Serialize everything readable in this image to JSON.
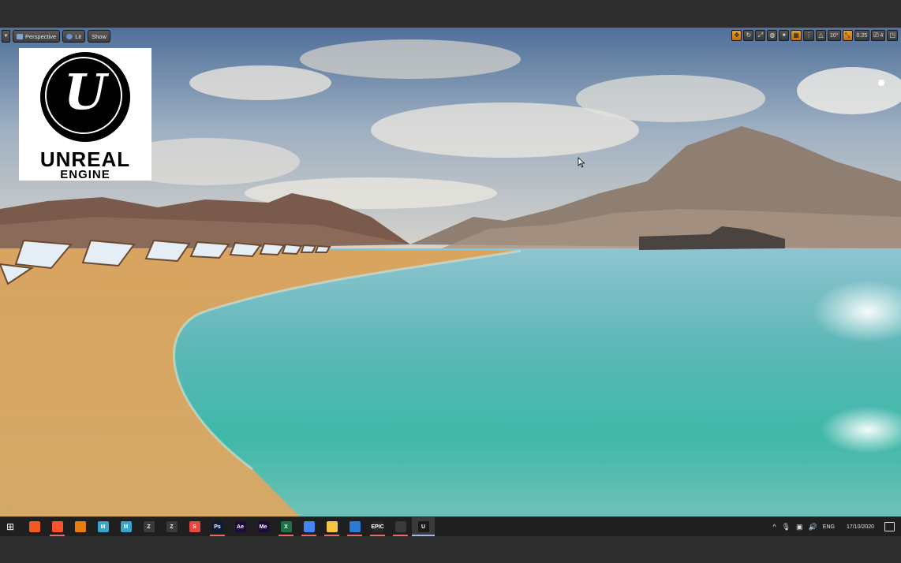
{
  "viewport": {
    "toolbar_left": {
      "perspective_label": "Perspective",
      "lit_label": "Lit",
      "show_label": "Show"
    },
    "toolbar_right": {
      "snap_angle": "10°",
      "camera_speed_value": "0.25",
      "camera_speed": "4"
    },
    "logo": {
      "glyph": "U",
      "line1": "UNREAL",
      "line2": "ENGINE"
    }
  },
  "taskbar": {
    "apps": [
      {
        "name": "origin-icon",
        "label": "",
        "color": "#f05a22",
        "running": false
      },
      {
        "name": "brave-icon",
        "label": "",
        "color": "#fb542b",
        "running": true
      },
      {
        "name": "blender-icon",
        "label": "",
        "color": "#e87d0d",
        "running": false
      },
      {
        "name": "maya-icon",
        "label": "M",
        "color": "#37a5cc",
        "running": false
      },
      {
        "name": "maya-2-icon",
        "label": "M",
        "color": "#37a5cc",
        "running": false
      },
      {
        "name": "zbrush-icon",
        "label": "Z",
        "color": "#3a3a3a",
        "running": false
      },
      {
        "name": "zbrush-2-icon",
        "label": "Z",
        "color": "#3a3a3a",
        "running": false
      },
      {
        "name": "substance-icon",
        "label": "S",
        "color": "#e2483d",
        "running": false
      },
      {
        "name": "photoshop-icon",
        "label": "Ps",
        "color": "#0a1e3a",
        "running": true
      },
      {
        "name": "after-effects-icon",
        "label": "Ae",
        "color": "#1f0a3a",
        "running": false
      },
      {
        "name": "media-encoder-icon",
        "label": "Me",
        "color": "#1f0a3a",
        "running": false
      },
      {
        "name": "excel-icon",
        "label": "X",
        "color": "#1e7145",
        "running": true
      },
      {
        "name": "docs-icon",
        "label": "",
        "color": "#4285f4",
        "running": true
      },
      {
        "name": "file-explorer-icon",
        "label": "",
        "color": "#f4c542",
        "running": true
      },
      {
        "name": "photos-icon",
        "label": "",
        "color": "#2a7ad6",
        "running": true
      },
      {
        "name": "epic-games-icon",
        "label": "EPIC",
        "color": "#2a2a2a",
        "running": true
      },
      {
        "name": "obs-icon",
        "label": "",
        "color": "#3a3a3a",
        "running": true
      },
      {
        "name": "unreal-engine-icon",
        "label": "U",
        "color": "#1a1a1a",
        "running": true,
        "selected": true
      }
    ],
    "tray": {
      "language": "ENG",
      "date": "17/10/2020"
    }
  },
  "colors": {
    "accent": "#f0a020",
    "taskbar_bg": "#1f1f1f"
  }
}
